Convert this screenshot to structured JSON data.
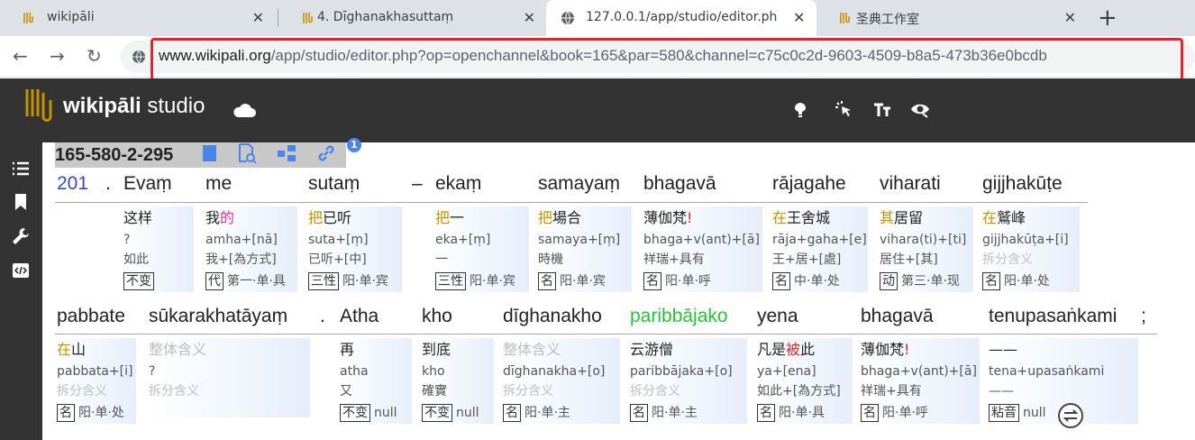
{
  "browser": {
    "tabs": [
      {
        "title": "wikipāli",
        "close": "✕"
      },
      {
        "title": "4. Dīghanakhasuttaṃ",
        "close": "✕"
      },
      {
        "title": "127.0.0.1/app/studio/editor.ph",
        "close": "✕"
      },
      {
        "title": "圣典工作室",
        "close": "✕"
      }
    ],
    "new_tab": "+",
    "url_host": "www.wikipali.org",
    "url_rest": "/app/studio/editor.php?op=openchannel&book=165&par=580&channel=c75c0c2d-9603-4509-b8a5-473b36e0bcdb",
    "nav": {
      "back": "←",
      "forward": "→",
      "reload": "↻"
    }
  },
  "app": {
    "brand_bold": "wikipāli",
    "brand_light": " studio",
    "tools": [
      "highlight-icon",
      "pointer-icon",
      "font-size-icon",
      "view-icon"
    ],
    "sidebar": [
      "menu-icon",
      "bookmark-icon",
      "wrench-icon",
      "code-icon"
    ]
  },
  "sentence": {
    "id": "165-580-2-295",
    "info": "1"
  },
  "row1": {
    "para": "201",
    "dot": ".",
    "dash": "–",
    "words": [
      "Evaṃ",
      "me",
      "sutaṃ",
      "ekaṃ",
      "samayaṃ",
      "bhagavā",
      "rājagahe",
      "viharati",
      "gijjhakūṭe"
    ]
  },
  "row2": {
    "words": [
      "pabbate",
      "sūkarakhatāyaṃ",
      ".",
      "Atha",
      "kho",
      "dīghanakho",
      "paribbājako",
      "yena",
      "bhagavā",
      "tenupasaṅkami",
      ";"
    ]
  },
  "cards1": [
    {
      "m1": "这样",
      "m2": "?",
      "m3": "如此",
      "tag": "不变",
      "after": ""
    },
    {
      "m1a": "我",
      "m1b": "的",
      "m2": "amha+[nā]",
      "m3": "我+[為方式]",
      "tag": "代",
      "after": "第一·单·具"
    },
    {
      "m1a": "把",
      "m1b": "已听",
      "m2": "suta+[ṃ]",
      "m3": "已听+[中]",
      "tag": "三性",
      "after": "阳·单·宾"
    },
    {
      "m1a": "把",
      "m1b": "一",
      "m2": "eka+[ṃ]",
      "m3": "一",
      "tag": "三性",
      "after": "阳·单·宾"
    },
    {
      "m1a": "把",
      "m1b": "場合",
      "m2": "samaya+[ṃ]",
      "m3": "時機",
      "tag": "名",
      "after": "阳·单·宾"
    },
    {
      "m1a": "薄伽梵",
      "m1b": "!",
      "m2": "bhaga+v(ant)+[ā]",
      "m3": "祥瑞+具有",
      "tag": "名",
      "after": "阳·单·呼"
    },
    {
      "m1a": "在",
      "m1b": "王舍城",
      "m2": "rāja+gaha+[e]",
      "m3": "王+居+[處]",
      "tag": "名",
      "after": "中·单·处"
    },
    {
      "m1a": "其",
      "m1b": "居留",
      "m2": "vihara(ti)+[ti]",
      "m3": "居住+[其]",
      "tag": "动",
      "after": "第三·单·现"
    },
    {
      "m1a": "在",
      "m1b": "鷲峰",
      "m2": "gijjhakūṭa+[i]",
      "m3": "拆分含义",
      "tag": "名",
      "after": "阳·单·处"
    }
  ],
  "cards2": [
    {
      "m1a": "在",
      "m1b": "山",
      "m2": "pabbata+[i]",
      "m3": "拆分含义",
      "tag": "名",
      "after": "阳·单·处"
    },
    {
      "m1": "整体含义",
      "m2": "?",
      "m3": "拆分含义",
      "tag": "",
      "after": ""
    },
    {
      "m1": "再",
      "m2": "atha",
      "m3": "又",
      "tag": "不变",
      "after": "null"
    },
    {
      "m1": "到底",
      "m2": "kho",
      "m3": "確實",
      "tag": "不变",
      "after": "null"
    },
    {
      "m1": "整体含义",
      "m2": "dīghanakha+[o]",
      "m3": "拆分含义",
      "tag": "名",
      "after": "阳·单·主"
    },
    {
      "m1": "云游僧",
      "m2": "paribbājaka+[o]",
      "m3": "拆分含义",
      "tag": "名",
      "after": "阳·单·主"
    },
    {
      "m1a": "凡是",
      "m1b": "被",
      "m1c": "此",
      "m2": "ya+[ena]",
      "m3": "如此+[為方式]",
      "tag": "名",
      "after": "阳·单·具"
    },
    {
      "m1a": "薄伽梵",
      "m1b": "!",
      "m2": "bhaga+v(ant)+[ā]",
      "m3": "祥瑞+具有",
      "tag": "名",
      "after": "阳·单·呼"
    },
    {
      "m1": "——",
      "m2": "tena+upasaṅkami",
      "m3": "——",
      "tag": "粘音",
      "after": "null"
    }
  ]
}
